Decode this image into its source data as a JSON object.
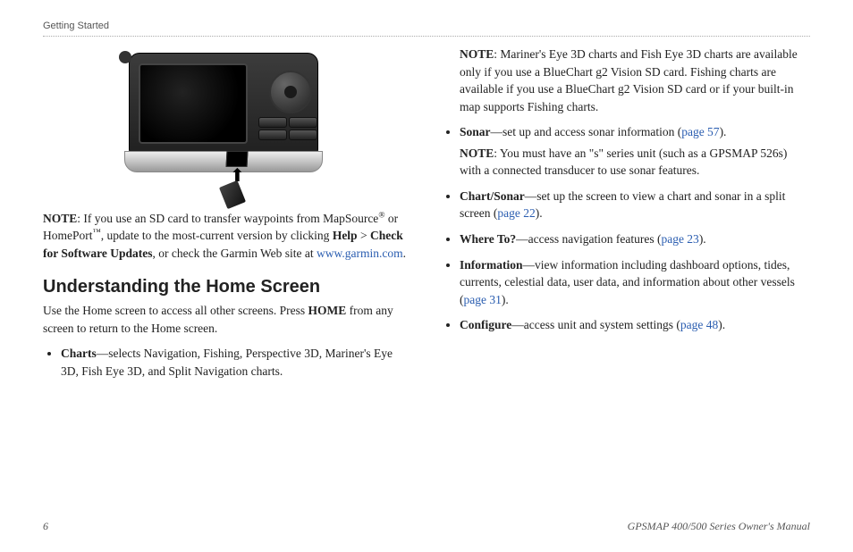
{
  "chapter": "Getting Started",
  "noteLabel": "NOTE",
  "sdNote": {
    "pre": ": If you use an SD card to transfer waypoints from MapSource",
    "reg": "®",
    "mid1": " or HomePort",
    "tm": "™",
    "mid2": ", update to the most-current version by clicking ",
    "help": "Help",
    "gt": " > ",
    "check": "Check for Software Updates",
    "post": ", or check the Garmin Web site at ",
    "url": "www.garmin.com",
    "dot": "."
  },
  "sectionTitle": "Understanding the Home Screen",
  "intro": {
    "pre": "Use the Home screen to access all other screens. Press ",
    "home": "HOME",
    "post": " from any screen to return to the Home screen."
  },
  "chartsItem": {
    "label": "Charts",
    "text": "—selects Navigation, Fishing, Perspective 3D, Mariner's Eye 3D, Fish Eye 3D, and Split Navigation charts."
  },
  "colRightNote": ": Mariner's Eye 3D charts and Fish Eye 3D charts are available only if you use a BlueChart g2 Vision SD card. Fishing charts are available if you use a BlueChart g2 Vision SD card or if your built-in map supports Fishing charts.",
  "items": {
    "sonar": {
      "label": "Sonar",
      "text": "—set up and access sonar information (",
      "link": "page 57",
      "after": ")."
    },
    "sonarNote": ": You must have an \"s\" series unit (such as a GPSMAP 526s) with a connected transducer to use sonar features.",
    "chartSonar": {
      "label": "Chart/Sonar",
      "text": "—set up the screen to view a chart and sonar in a split screen (",
      "link": "page 22",
      "after": ")."
    },
    "whereTo": {
      "label": "Where To?",
      "text": "—access navigation features (",
      "link": "page 23",
      "after": ")."
    },
    "information": {
      "label": "Information",
      "text": "—view information including dashboard options, tides, currents, celestial data, user data, and information about other vessels (",
      "link": "page 31",
      "after": ")."
    },
    "configure": {
      "label": "Configure",
      "text": "—access unit and system settings (",
      "link": "page 48",
      "after": ")."
    }
  },
  "footer": {
    "pageNum": "6",
    "manualTitle": "GPSMAP 400/500 Series Owner's Manual"
  }
}
